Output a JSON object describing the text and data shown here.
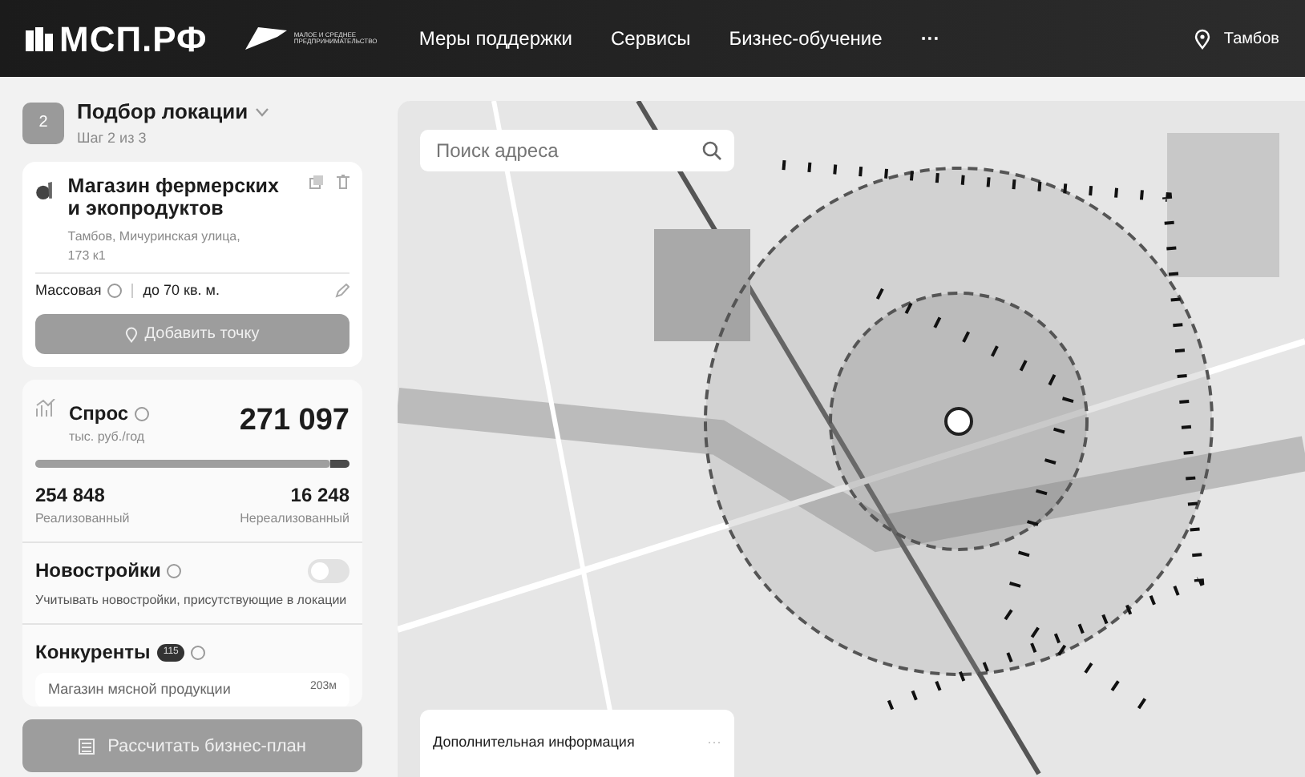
{
  "header": {
    "logo": "МСП.РФ",
    "partner_logo": "МАЛОЕ И СРЕДНЕЕ ПРЕДПРИНИМАТЕЛЬСТВО",
    "nav": [
      {
        "label": "Меры поддержки"
      },
      {
        "label": "Сервисы"
      },
      {
        "label": "Бизнес-обучение"
      }
    ],
    "more": "···",
    "city": "Тамбов"
  },
  "step": {
    "number": "2",
    "title": "Подбор локации",
    "subtitle": "Шаг 2 из 3"
  },
  "location": {
    "name": "Магазин фермерских и экопродуктов",
    "address": "Тамбов, Мичуринская улица, 173 к1",
    "format": "Массовая",
    "area": "до 70 кв. м.",
    "add_button": "Добавить точку"
  },
  "demand": {
    "title": "Спрос",
    "unit": "тыс. руб./год",
    "total": "271 097",
    "level": 0.94,
    "realized": "254 848",
    "realized_label": "Реализованный",
    "unrealized": "16 248",
    "unrealized_label": "Нереализованный"
  },
  "new_buildings": {
    "title": "Новостройки",
    "on": false,
    "description": "Учитывать новостройки, присутствующие в локации"
  },
  "competitors": {
    "title": "Конкуренты",
    "count": "115",
    "items": [
      {
        "name": "Магазин мясной продукции",
        "distance": "203м"
      }
    ]
  },
  "calc_button": "Рассчитать бизнес-план",
  "map": {
    "kind": "picture",
    "search_placeholder": "Поиск адреса",
    "info_panel": "Дополнительная информация",
    "info_more": "···"
  }
}
